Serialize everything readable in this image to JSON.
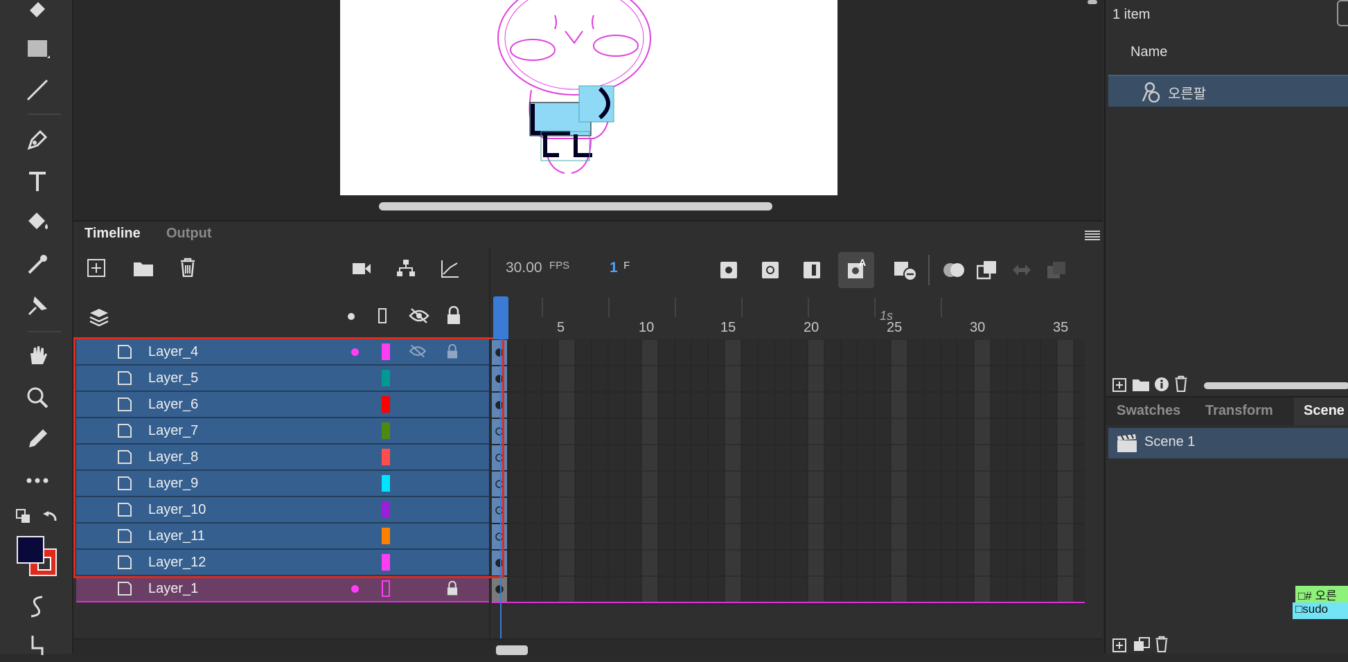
{
  "tabs": {
    "timeline": "Timeline",
    "output": "Output"
  },
  "fps": {
    "value": "30.00",
    "unit": "FPS"
  },
  "frame": {
    "value": "1",
    "unit": "F"
  },
  "frame_numbers": [
    "5",
    "10",
    "15",
    "20",
    "25",
    "30",
    "35"
  ],
  "seconds_marker": "1s",
  "layers": [
    {
      "name": "Layer_4",
      "color": "#ff3df5"
    },
    {
      "name": "Layer_5",
      "color": "#009a93"
    },
    {
      "name": "Layer_6",
      "color": "#ff0000"
    },
    {
      "name": "Layer_7",
      "color": "#4f8a10"
    },
    {
      "name": "Layer_8",
      "color": "#ff4d4d"
    },
    {
      "name": "Layer_9",
      "color": "#00e5ff"
    },
    {
      "name": "Layer_10",
      "color": "#9a1fd8"
    },
    {
      "name": "Layer_11",
      "color": "#ff8000"
    },
    {
      "name": "Layer_12",
      "color": "#ff3df5"
    },
    {
      "name": "Layer_1",
      "color": "#ff3df5"
    }
  ],
  "library": {
    "count": "1 item",
    "name_header": "Name",
    "item": "오른팔"
  },
  "right_tabs": {
    "swatches": "Swatches",
    "transform": "Transform",
    "scene": "Scene"
  },
  "scene": {
    "item": "Scene 1"
  },
  "stickers": {
    "first": "□# 오른",
    "second": "□sudo"
  },
  "colors": {
    "fill": "#0a0a3a",
    "stroke": "#e02a1c",
    "selection": "#345f8f",
    "accent": "#3a7bd5"
  }
}
